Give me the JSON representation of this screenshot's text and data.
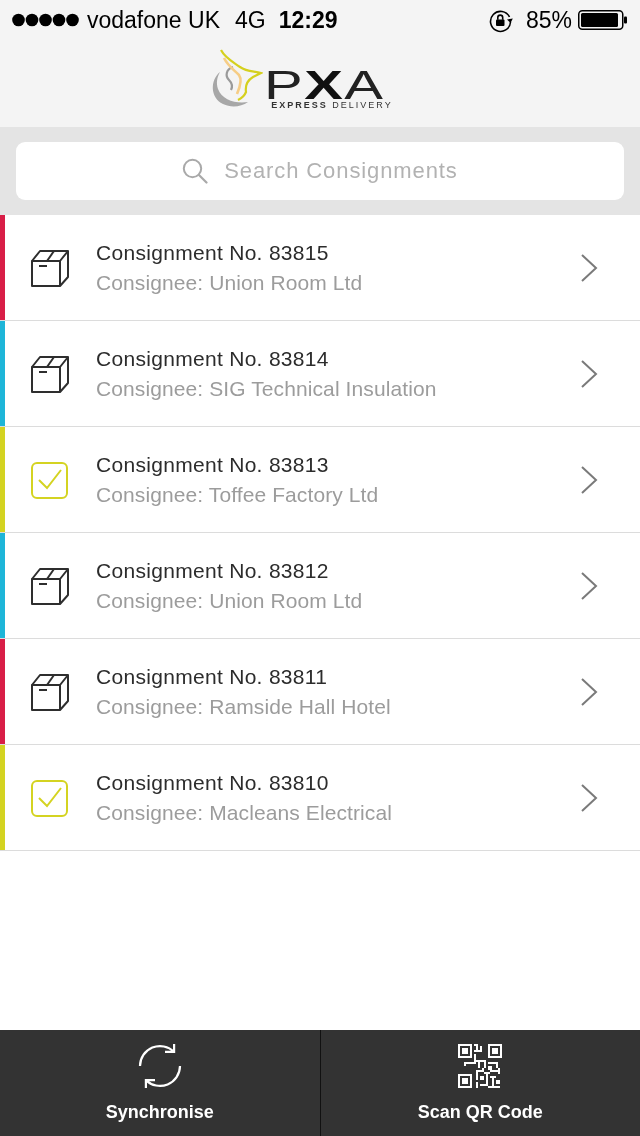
{
  "status_bar": {
    "carrier": "vodafone UK",
    "network": "4G",
    "time": "12:29",
    "battery": "85%"
  },
  "header": {
    "logo": "P**X**A",
    "tagline": "**EXPRESS** DELIVERY"
  },
  "search": {
    "placeholder": "Search Consignments"
  },
  "consignments": [
    {
      "title": "Consignment No. 83815",
      "consignee": "Consignee: Union Room Ltd",
      "color": "#d81e47",
      "delivered": false
    },
    {
      "title": "Consignment No. 83814",
      "consignee": "Consignee: SIG Technical Insulation",
      "color": "#1eb5d8",
      "delivered": false
    },
    {
      "title": "Consignment No. 83813",
      "consignee": "Consignee: Toffee Factory Ltd",
      "color": "#d4d321",
      "delivered": true
    },
    {
      "title": "Consignment No. 83812",
      "consignee": "Consignee: Union Room Ltd",
      "color": "#1eb5d8",
      "delivered": false
    },
    {
      "title": "Consignment No. 83811",
      "consignee": "Consignee: Ramside Hall Hotel",
      "color": "#d81e47",
      "delivered": false
    },
    {
      "title": "Consignment No. 83810",
      "consignee": "Consignee: Macleans Electrical",
      "color": "#d4d321",
      "delivered": true
    }
  ],
  "toolbar": [
    {
      "kind": "sync",
      "label": "Synchronise"
    },
    {
      "kind": "qr",
      "label": "Scan QR Code"
    }
  ]
}
